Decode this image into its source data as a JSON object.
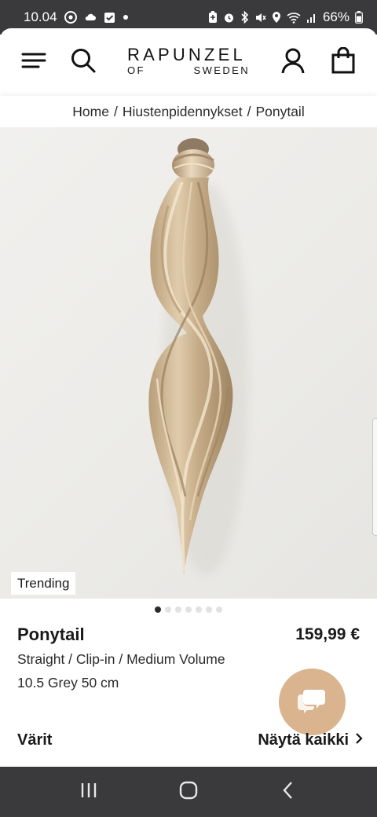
{
  "status_bar": {
    "time": "10.04",
    "battery": "66%",
    "left_icons": [
      "chrome-icon",
      "cloud-icon",
      "checkbox-notification-icon",
      "dot-icon"
    ],
    "right_icons": [
      "battery-saver-icon",
      "alarm-icon",
      "bluetooth-icon",
      "mute-icon",
      "location-icon",
      "wifi-icon",
      "signal-icon",
      "battery-icon"
    ]
  },
  "header": {
    "brand_top": "RAPUNZEL",
    "brand_bottom_left": "OF",
    "brand_bottom_right": "SWEDEN",
    "icons": [
      "menu-icon",
      "search-icon",
      "account-icon",
      "cart-icon"
    ]
  },
  "breadcrumb": {
    "items": [
      "Home",
      "Hiustenpidennykset",
      "Ponytail"
    ],
    "separator": "/"
  },
  "gallery": {
    "badge": "Trending",
    "dot_count": 7,
    "active_index": 0
  },
  "product": {
    "title": "Ponytail",
    "price": "159,99 €",
    "variant": "Straight / Clip-in / Medium Volume",
    "color_length": "10.5 Grey 50 cm"
  },
  "colors_section": {
    "label": "Värit",
    "link": "Näytä kaikki"
  },
  "colors": {
    "status_bar_bg": "#3a3a3c",
    "chat_button": "#d9b48f",
    "text": "#1a1a1a"
  }
}
